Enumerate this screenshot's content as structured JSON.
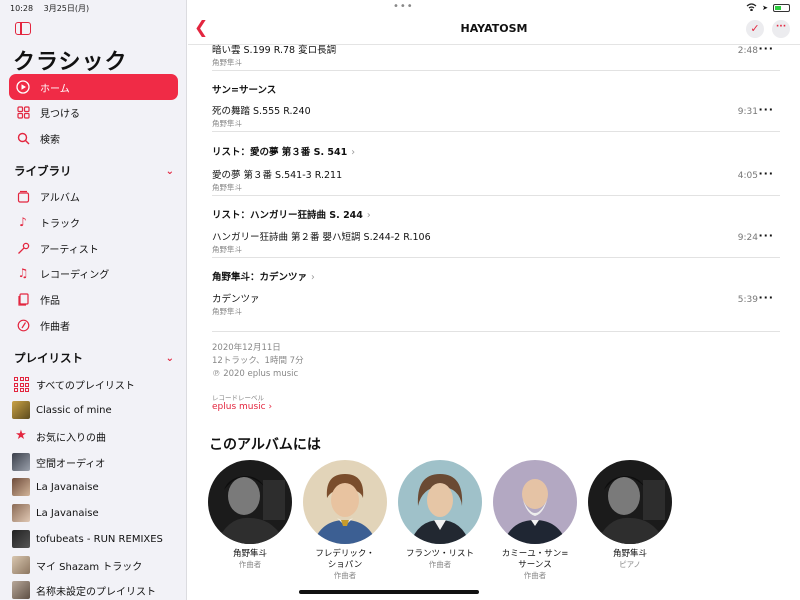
{
  "status": {
    "time": "10:28",
    "date": "3月25日(月)"
  },
  "sidebar": {
    "title": "クラシック",
    "nav": [
      {
        "label": "ホーム",
        "icon": "play-circle-icon"
      },
      {
        "label": "見つける",
        "icon": "grid-icon"
      },
      {
        "label": "検索",
        "icon": "search-icon"
      }
    ],
    "library": {
      "heading": "ライブラリ",
      "items": [
        {
          "label": "アルバム",
          "icon": "album-icon"
        },
        {
          "label": "トラック",
          "icon": "music-note-icon"
        },
        {
          "label": "アーティスト",
          "icon": "microphone-icon"
        },
        {
          "label": "レコーディング",
          "icon": "recording-icon"
        },
        {
          "label": "作品",
          "icon": "work-icon"
        },
        {
          "label": "作曲者",
          "icon": "composer-icon"
        }
      ]
    },
    "playlists": {
      "heading": "プレイリスト",
      "items": [
        {
          "label": "すべてのプレイリスト"
        },
        {
          "label": "Classic of mine"
        },
        {
          "label": "お気に入りの曲"
        },
        {
          "label": "空間オーディオ"
        },
        {
          "label": "La Javanaise"
        },
        {
          "label": "La Javanaise"
        },
        {
          "label": "tofubeats - RUN REMIXES"
        },
        {
          "label": "マイ Shazam トラック"
        },
        {
          "label": "名称未設定のプレイリスト"
        }
      ]
    }
  },
  "nav_bar": {
    "title": "HAYATOSM"
  },
  "sections": [
    {
      "title": "",
      "tracks": [
        {
          "name": "暗い雲 S.199 R.78 変ロ長調",
          "artist": "角野隼斗",
          "duration": "2:48"
        }
      ]
    },
    {
      "title": "サン=サーンス",
      "tracks": [
        {
          "name": "死の舞踏 S.555 R.240",
          "artist": "角野隼斗",
          "duration": "9:31"
        }
      ]
    },
    {
      "title": "リスト：愛の夢 第３番 S. 541",
      "tracks": [
        {
          "name": "愛の夢 第３番 S.541-3 R.211",
          "artist": "角野隼斗",
          "duration": "4:05"
        }
      ]
    },
    {
      "title": "リスト：ハンガリー狂詩曲 S. 244",
      "tracks": [
        {
          "name": "ハンガリー狂詩曲 第２番 嬰ハ短調 S.244-2 R.106",
          "artist": "角野隼斗",
          "duration": "9:24"
        }
      ]
    },
    {
      "title": "角野隼斗：カデンツァ",
      "tracks": [
        {
          "name": "カデンツァ",
          "artist": "角野隼斗",
          "duration": "5:39"
        }
      ]
    }
  ],
  "album_meta": {
    "date": "2020年12月11日",
    "summary": "12トラック、1時間 7分",
    "copyright": "℗ 2020 eplus music",
    "label_caption": "レコードレーベル",
    "label_name": "eplus music"
  },
  "in_album": {
    "heading": "このアルバムには",
    "artists": [
      {
        "name": "角野隼斗",
        "role": "作曲者"
      },
      {
        "name": "フレデリック・ショパン",
        "name_lines": [
          "フレデリック・",
          "ショパン"
        ],
        "role": "作曲者"
      },
      {
        "name": "フランツ・リスト",
        "role": "作曲者"
      },
      {
        "name": "カミーユ・サン=サーンス",
        "name_lines": [
          "カミーユ・サン=",
          "サーンス"
        ],
        "role": "作曲者"
      },
      {
        "name": "角野隼斗",
        "role": "ピアノ"
      }
    ]
  },
  "colors": {
    "accent": "#e3263f",
    "active_bg": "#f02b46"
  }
}
